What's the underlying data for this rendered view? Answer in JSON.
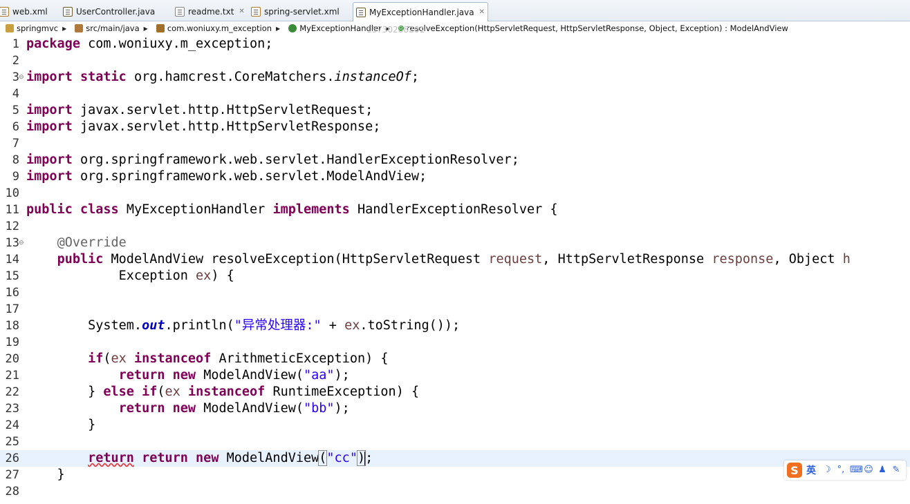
{
  "tabs": [
    {
      "label": "web.xml",
      "icon": "xml-file-icon",
      "active": false
    },
    {
      "label": "UserController.java",
      "icon": "java-file-icon",
      "active": false
    },
    {
      "label": "readme.txt",
      "icon": "text-file-icon",
      "active": false
    },
    {
      "label": "spring-servlet.xml",
      "icon": "xml-file-icon",
      "active": false
    },
    {
      "label": "MyExceptionHandler.java",
      "icon": "java-file-icon",
      "active": true
    }
  ],
  "breadcrumb": {
    "project": "springmvc",
    "source_folder": "src/main/java",
    "package": "com.woniuxy.m_exception",
    "class": "MyExceptionHandler",
    "method": "resolveException(HttpServletRequest, HttpServletResponse, Object, Exception) : ModelAndView"
  },
  "watermark": "15730288201",
  "code": {
    "l1": {
      "num": "1",
      "pkg": "com.woniuxy.m_exception;"
    },
    "l3": {
      "num": "3",
      "path": "org.hamcrest.CoreMatchers.",
      "method": "instanceOf"
    },
    "l5": {
      "num": "5",
      "path": "javax.servlet.http.HttpServletRequest;"
    },
    "l6": {
      "num": "6",
      "path": "javax.servlet.http.HttpServletResponse;"
    },
    "l8": {
      "num": "8",
      "path": "org.springframework.web.servlet.HandlerExceptionResolver;"
    },
    "l9": {
      "num": "9",
      "path": "org.springframework.web.servlet.ModelAndView;"
    },
    "l11": {
      "num": "11",
      "class_name": "MyExceptionHandler",
      "interface": "HandlerExceptionResolver"
    },
    "l13": {
      "num": "13",
      "annotation": "@Override"
    },
    "l14": {
      "num": "14",
      "return_type": "ModelAndView",
      "method": "resolveException",
      "t1": "HttpServletRequest",
      "p1": "request",
      "t2": "HttpServletResponse",
      "p2": "response",
      "t3": "Object",
      "p3": "h"
    },
    "l15": {
      "num": "15",
      "t4": "Exception",
      "p4": "ex"
    },
    "l18": {
      "num": "18",
      "obj": "System.",
      "field": "out",
      "call": ".println(",
      "str": "\"异常处理器:\"",
      "var": "ex",
      "tail": ".toString());"
    },
    "l20": {
      "num": "20",
      "var": "ex",
      "type": "ArithmeticException"
    },
    "l21": {
      "num": "21",
      "cls": "ModelAndView(",
      "str": "\"aa\""
    },
    "l22": {
      "num": "22",
      "var": "ex",
      "type": "RuntimeException"
    },
    "l23": {
      "num": "23",
      "cls": "ModelAndView(",
      "str": "\"bb\""
    },
    "l26": {
      "num": "26",
      "cls": "ModelAndView",
      "str": "\"cc\""
    },
    "nums": {
      "n2": "2",
      "n4": "4",
      "n7": "7",
      "n10": "10",
      "n12": "12",
      "n16": "16",
      "n17": "17",
      "n19": "19",
      "n24": "24",
      "n25": "25",
      "n27": "27",
      "n28": "28"
    }
  },
  "keywords": {
    "package": "package",
    "import": "import",
    "static": "static",
    "public": "public",
    "class": "class",
    "implements": "implements",
    "if": "if",
    "instanceof": "instanceof",
    "else": "else",
    "return": "return",
    "new": "new"
  },
  "ime": {
    "logo": "S",
    "lang": "英"
  },
  "colors": {
    "keyword": "#7f0055",
    "string": "#2a00ff",
    "variable": "#6a3e3e",
    "annotation": "#646464",
    "current_line": "#e8f2fe"
  }
}
